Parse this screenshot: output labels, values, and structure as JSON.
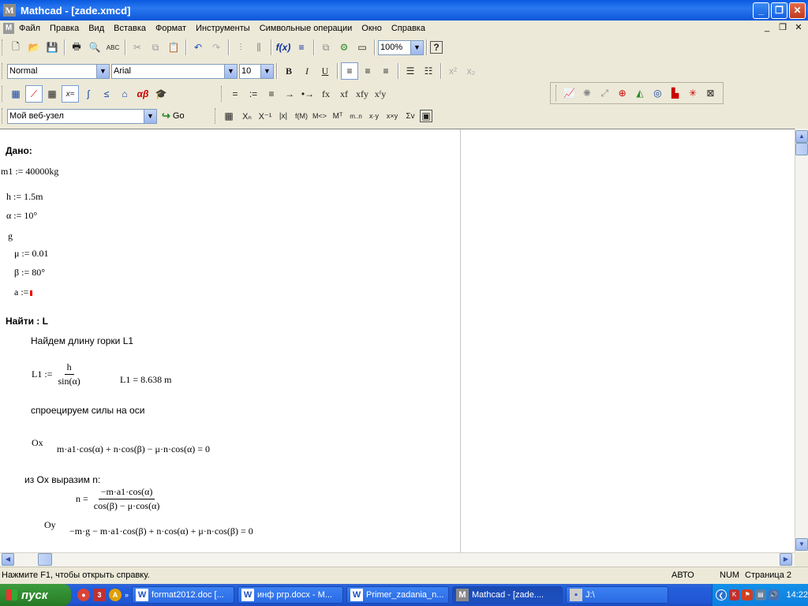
{
  "window": {
    "title": "Mathcad - [zade.xmcd]",
    "logo": "M"
  },
  "menu": [
    "Файл",
    "Правка",
    "Вид",
    "Вставка",
    "Формат",
    "Инструменты",
    "Символьные операции",
    "Окно",
    "Справка"
  ],
  "toolbar": {
    "zoom": "100%",
    "style": "Normal",
    "font": "Arial",
    "size": "10",
    "bold": "B",
    "italic": "I",
    "underline": "U",
    "math_row": [
      "=",
      ":=",
      "≡",
      "→",
      "•→",
      "fx",
      "xf",
      "xfy",
      "xᶠy"
    ],
    "matrix_row": [
      "Xₙ",
      "X⁻¹",
      "|x|",
      "f(M)",
      "M<>",
      "Mᵀ",
      "m..n",
      "x·y",
      "x×y",
      "Σv"
    ],
    "url": "Мой веб-узел",
    "go": "Go"
  },
  "worksheet": {
    "given": "Дано:",
    "m1": "m1 := 40000kg",
    "h": "h := 1.5m",
    "alpha": "α := 10°",
    "g": "g",
    "mu": "μ := 0.01",
    "beta": "β := 80°",
    "a": "a :=",
    "find": "Найти : L",
    "find_length": "Найдем длину горки L1",
    "L1_lhs": "L1 :=",
    "L1_num": "h",
    "L1_den": "sin(α)",
    "L1_result": "L1 = 8.638 m",
    "project": "спроецируем силы на оси",
    "ox": "Ox",
    "ox_eq": "m·a1·cos(α) + n·cos(β) − μ·n·cos(α) = 0",
    "express": "из Ox выразим n:",
    "n_lhs": "n =",
    "n_num": "−m·a1·cos(α)",
    "n_den": "cos(β) − μ·cos(α)",
    "oy": "Oy",
    "oy_eq": "−m·g − m·a1·cos(β) + n·cos(α) + μ·n·cos(β) = 0"
  },
  "status": {
    "hint": "Нажмите F1, чтобы открыть справку.",
    "mode": "АВТО",
    "num": "NUM",
    "page": "Страница 2"
  },
  "taskbar": {
    "start": "пуск",
    "tasks": [
      {
        "icon": "W",
        "label": "format2012.doc [..."
      },
      {
        "icon": "W",
        "label": "инф ргр.docx - M..."
      },
      {
        "icon": "W",
        "label": "Primer_zadania_n..."
      },
      {
        "icon": "M",
        "label": "Mathcad - [zade...."
      },
      {
        "icon": "▪",
        "label": "J:\\"
      }
    ],
    "clock": "14:22"
  }
}
